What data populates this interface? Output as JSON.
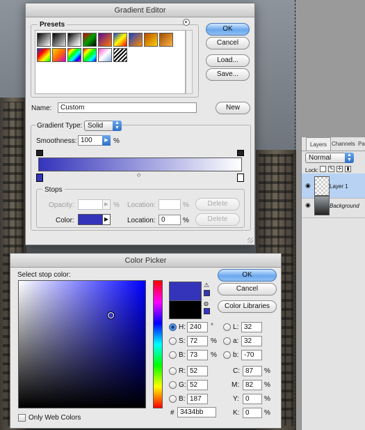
{
  "gradient_editor": {
    "title": "Gradient Editor",
    "presets_label": "Presets",
    "ok": "OK",
    "cancel": "Cancel",
    "load": "Load...",
    "save": "Save...",
    "name_label": "Name:",
    "name_value": "Custom",
    "new_button": "New",
    "gradient_type_label": "Gradient Type:",
    "gradient_type_value": "Solid",
    "smoothness_label": "Smoothness:",
    "smoothness_value": "100",
    "smoothness_unit": "%",
    "stops_label": "Stops",
    "opacity_label": "Opacity:",
    "opacity_unit": "%",
    "location_label": "Location:",
    "location_unit": "%",
    "delete_label": "Delete",
    "color_label": "Color:",
    "color_location_value": "0",
    "gradient_start": "#3434bb",
    "gradient_end": "#ffffff"
  },
  "color_picker": {
    "title": "Color Picker",
    "select_label": "Select stop color:",
    "ok": "OK",
    "cancel": "Cancel",
    "color_libraries": "Color Libraries",
    "new_color": "#3434bb",
    "old_color": "#000000",
    "hsb": [
      {
        "label": "H:",
        "value": "240",
        "unit": "°",
        "selected": true
      },
      {
        "label": "S:",
        "value": "72",
        "unit": "%",
        "selected": false
      },
      {
        "label": "B:",
        "value": "73",
        "unit": "%",
        "selected": false
      }
    ],
    "lab": [
      {
        "label": "L:",
        "value": "32"
      },
      {
        "label": "a:",
        "value": "32"
      },
      {
        "label": "b:",
        "value": "-70"
      }
    ],
    "rgb": [
      {
        "label": "R:",
        "value": "52"
      },
      {
        "label": "G:",
        "value": "52"
      },
      {
        "label": "B:",
        "value": "187"
      }
    ],
    "cmyk": [
      {
        "label": "C:",
        "value": "87",
        "unit": "%"
      },
      {
        "label": "M:",
        "value": "82",
        "unit": "%"
      },
      {
        "label": "Y:",
        "value": "0",
        "unit": "%"
      },
      {
        "label": "K:",
        "value": "0",
        "unit": "%"
      }
    ],
    "hex_label": "#",
    "hex_value": "3434bb",
    "only_web_colors": "Only Web Colors"
  },
  "layers_panel": {
    "tabs": [
      "Layers",
      "Channels",
      "Pat"
    ],
    "blend_mode": "Normal",
    "lock_label": "Lock:",
    "layers": [
      {
        "name": "Layer 1",
        "selected": true
      },
      {
        "name": "Background",
        "selected": false
      }
    ]
  }
}
